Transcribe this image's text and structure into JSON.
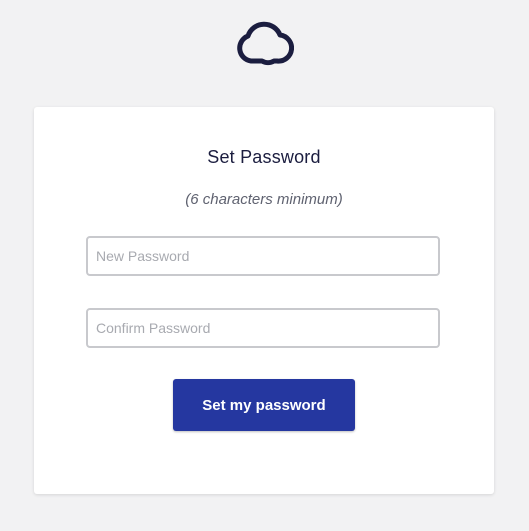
{
  "brand": {
    "logo_icon": "cloud-icon",
    "logo_color": "#1b1d3f"
  },
  "form": {
    "title": "Set Password",
    "subtitle": "(6 characters minimum)",
    "new_password": {
      "value": "",
      "placeholder": "New Password"
    },
    "confirm_password": {
      "value": "",
      "placeholder": "Confirm Password"
    },
    "submit_label": "Set my password",
    "accent_color": "#2537a0"
  }
}
